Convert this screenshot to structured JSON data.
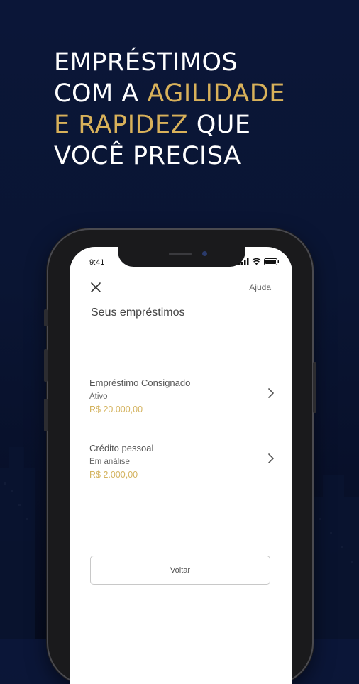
{
  "headline": {
    "line1": "EMPRÉSTIMOS",
    "line2_prefix": "COM A ",
    "line2_highlight": "AGILIDADE",
    "line3_highlight": "E RAPIDEZ",
    "line3_suffix": " QUE",
    "line4": "VOCÊ PRECISA"
  },
  "status_bar": {
    "time": "9:41",
    "icons": [
      "signal-icon",
      "wifi-icon",
      "battery-icon"
    ]
  },
  "header": {
    "close_icon": "close-icon",
    "help_label": "Ajuda"
  },
  "page_title": "Seus empréstimos",
  "loans": [
    {
      "name": "Empréstimo Consignado",
      "status": "Ativo",
      "amount": "R$ 20.000,00"
    },
    {
      "name": "Crédito pessoal",
      "status": "Em análise",
      "amount": "R$ 2.000,00"
    }
  ],
  "back_button_label": "Voltar",
  "colors": {
    "background": "#0a1533",
    "accent_gold": "#d8b15a",
    "amount_gold": "#d4b35f"
  }
}
